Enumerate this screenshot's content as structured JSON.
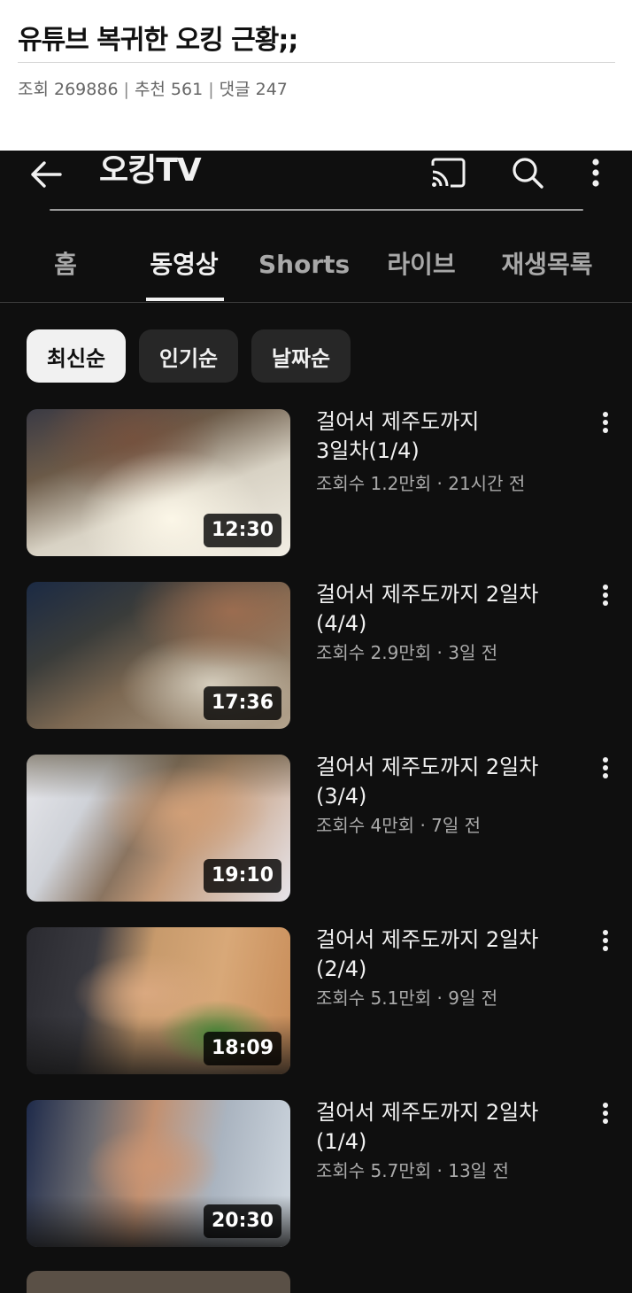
{
  "post": {
    "title": "유튜브 복귀한 오킹 근황;;",
    "views_label": "조회 269886",
    "recommend_label": "추천 561",
    "comments_label": "댓글 247",
    "separator": "|"
  },
  "app": {
    "channel_name": "오킹TV",
    "icons": [
      "back-arrow-icon",
      "cast-icon",
      "search-icon",
      "more-vertical-icon"
    ],
    "tabs": [
      {
        "label": "홈",
        "active": false
      },
      {
        "label": "동영상",
        "active": true
      },
      {
        "label": "Shorts",
        "active": false
      },
      {
        "label": "라이브",
        "active": false
      },
      {
        "label": "재생목록",
        "active": false
      }
    ],
    "chips": [
      {
        "label": "최신순",
        "selected": true
      },
      {
        "label": "인기순",
        "selected": false
      },
      {
        "label": "날짜순",
        "selected": false
      }
    ],
    "videos": [
      {
        "title": "걸어서 제주도까지\n3일차(1/4)",
        "meta": "조회수 1.2만회 · 21시간 전",
        "duration": "12:30"
      },
      {
        "title": "걸어서 제주도까지 2일차\n(4/4)",
        "meta": "조회수 2.9만회 · 3일 전",
        "duration": "17:36"
      },
      {
        "title": "걸어서 제주도까지 2일차\n(3/4)",
        "meta": "조회수 4만회 · 7일 전",
        "duration": "19:10"
      },
      {
        "title": "걸어서 제주도까지 2일차\n(2/4)",
        "meta": "조회수 5.1만회 · 9일 전",
        "duration": "18:09"
      },
      {
        "title": "걸어서 제주도까지 2일차\n(1/4)",
        "meta": "조회수 5.7만회 · 13일 전",
        "duration": "20:30"
      }
    ],
    "colors": {
      "background": "#0f0f0f",
      "chip": "#272727",
      "chip_selected": "#f1f1f1",
      "text_primary": "#f1f1f1",
      "text_secondary": "#aaaaaa"
    }
  }
}
